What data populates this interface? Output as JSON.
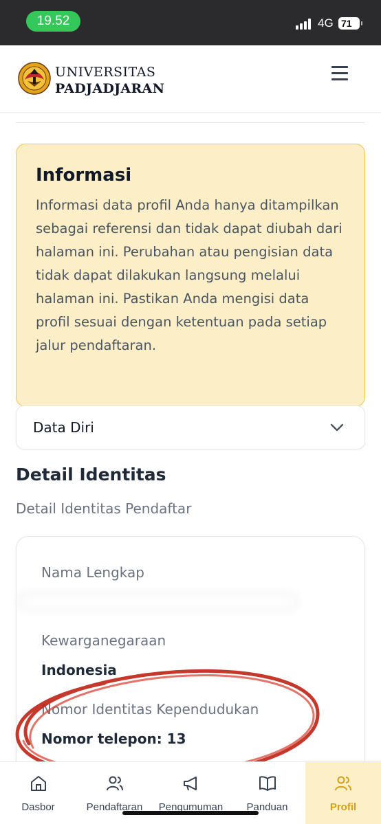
{
  "status_bar": {
    "time": "19.52",
    "network": "4G",
    "battery": "71"
  },
  "header": {
    "logo_line1": "UNIVERSITAS",
    "logo_line2": "PADJADJARAN"
  },
  "info": {
    "title": "Informasi",
    "body": "Informasi data profil Anda hanya ditampilkan sebagai referensi dan tidak dapat diubah dari halaman ini. Perubahan atau pengisian data tidak dapat dilakukan langsung melalui halaman ini. Pastikan Anda mengisi data profil sesuai dengan ketentuan pada setiap jalur pendaftaran."
  },
  "accordion": {
    "label": "Data Diri"
  },
  "section": {
    "title": "Detail Identitas",
    "subtitle": "Detail Identitas Pendaftar"
  },
  "fields": {
    "name_label": "Nama Lengkap",
    "citizenship_label": "Kewarganegaraan",
    "citizenship_value": "Indonesia",
    "nik_label": "Nomor Identitas Kependudukan",
    "nik_value": "Nomor telepon: 13"
  },
  "nav": {
    "items": [
      {
        "label": "Dasbor",
        "icon": "home-icon"
      },
      {
        "label": "Pendaftaran",
        "icon": "users-icon"
      },
      {
        "label": "Pengumuman",
        "icon": "megaphone-icon"
      },
      {
        "label": "Panduan",
        "icon": "book-icon"
      },
      {
        "label": "Profil",
        "icon": "users-icon"
      }
    ],
    "active": "Profil"
  },
  "colors": {
    "accent": "#d4a017",
    "info_bg": "#fcefc7",
    "info_border": "#f0c54a",
    "annotation": "#c0281b",
    "status_green": "#34c759"
  }
}
